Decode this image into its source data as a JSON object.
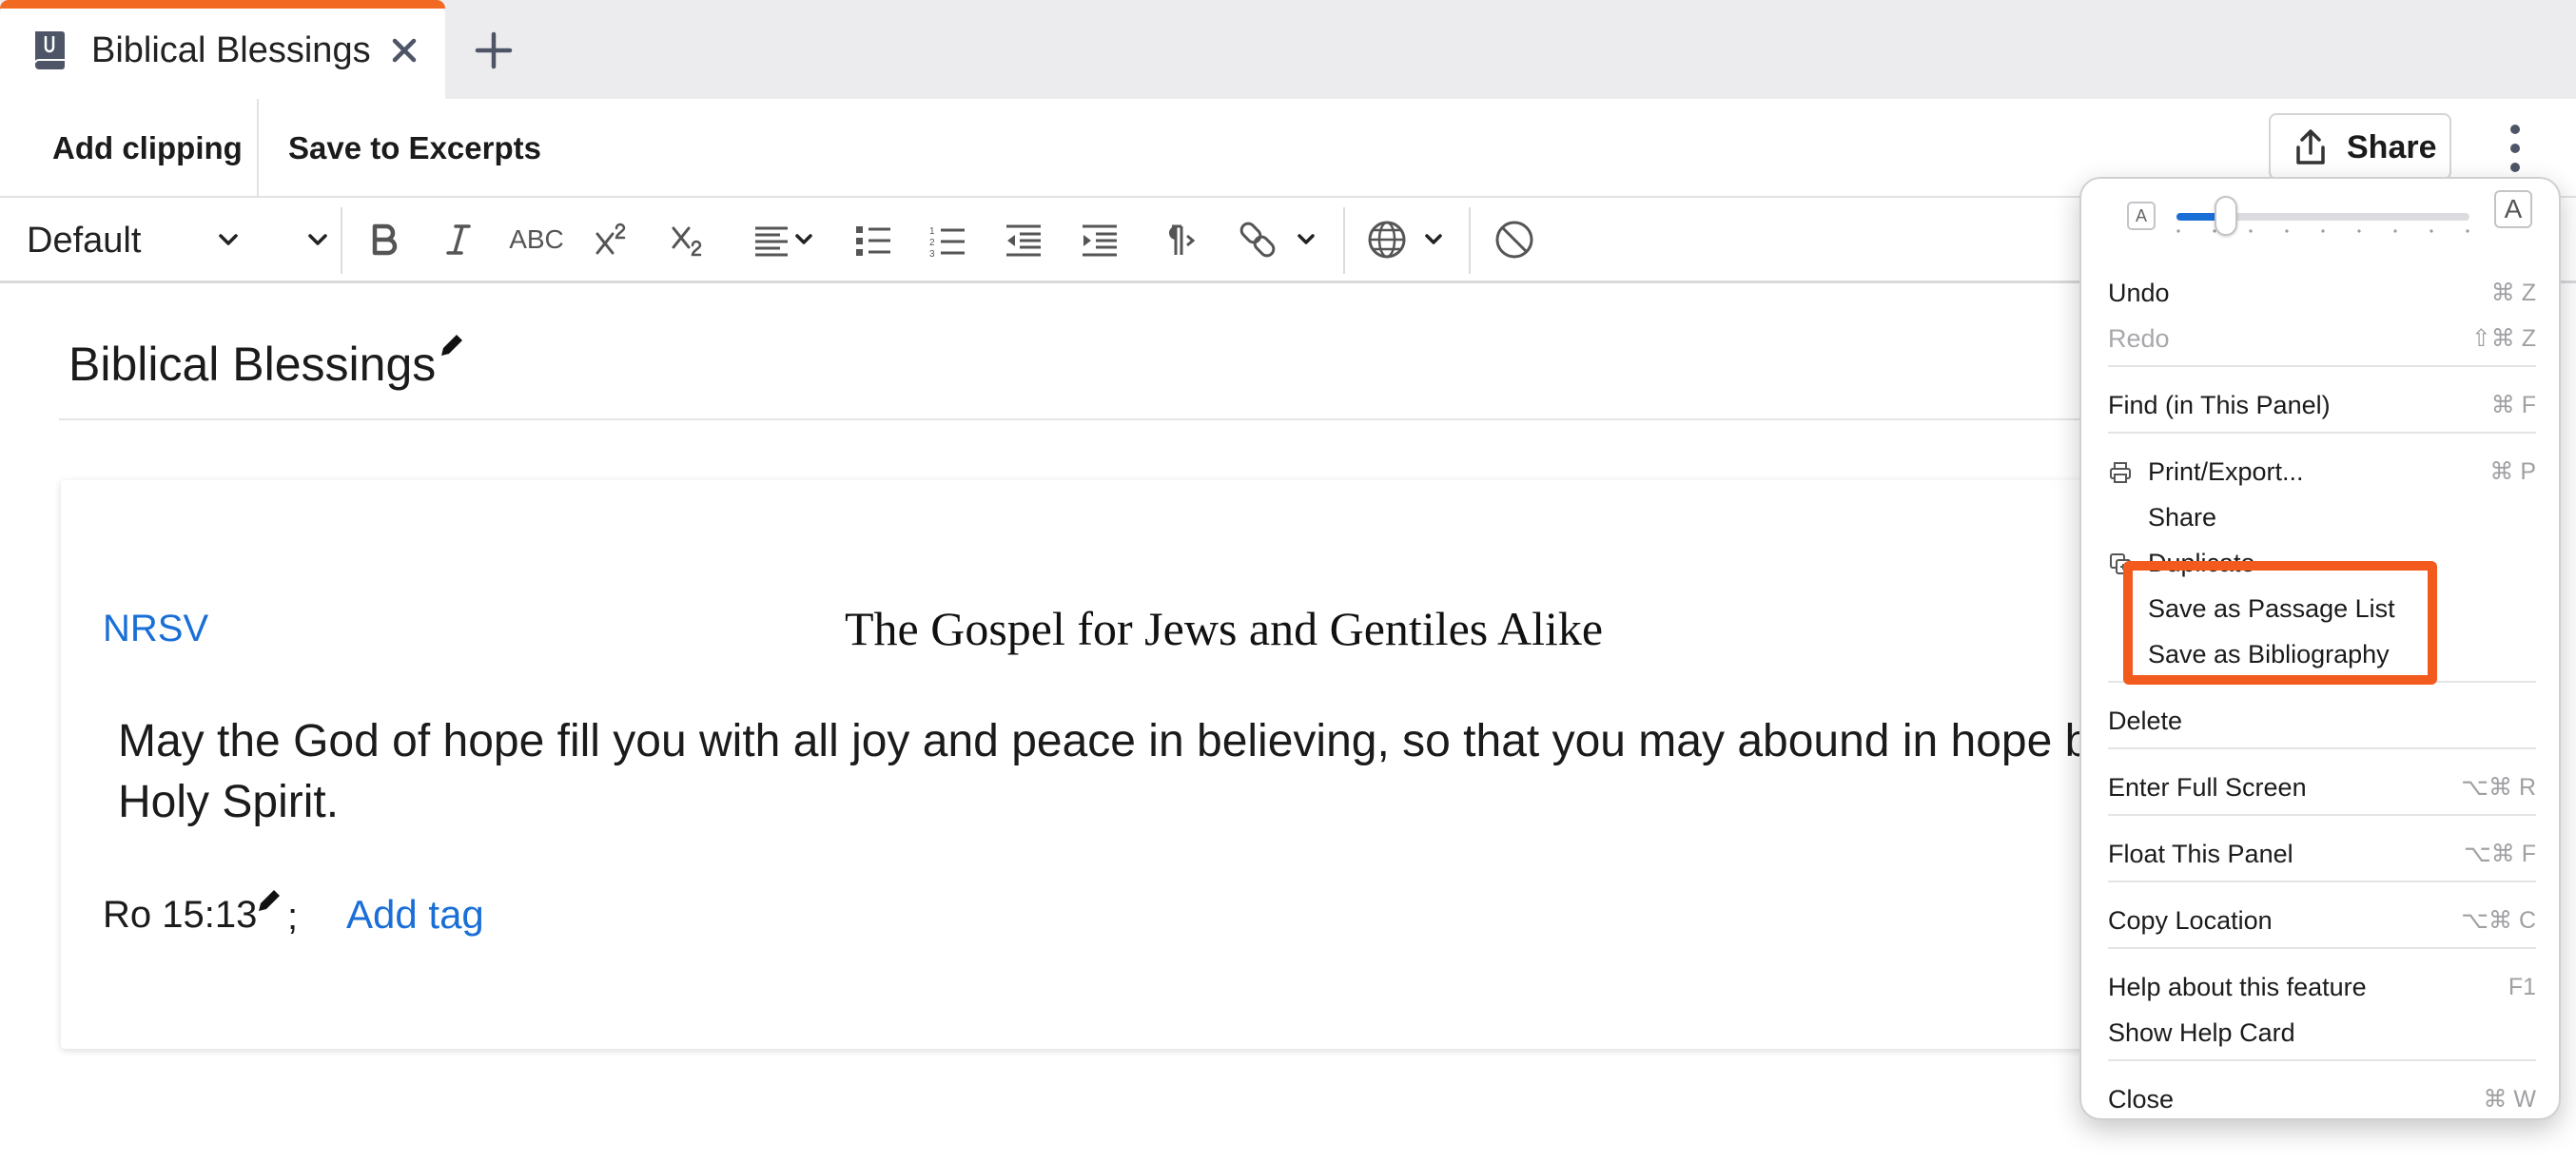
{
  "tab": {
    "title": "Biblical Blessings",
    "accent_color": "#f26a21"
  },
  "actions": {
    "add_clipping": "Add clipping",
    "save_to_excerpts": "Save to Excerpts",
    "share": "Share"
  },
  "format_toolbar": {
    "style_value": "Default",
    "strikethrough_label": "ABC"
  },
  "document": {
    "title": "Biblical Blessings",
    "version": "NRSV",
    "heading": "The Gospel for Jews and Gentiles Alike",
    "passage": "May the God of hope fill you with all joy and peace in believing, so that you may abound in hope b",
    "passage_line2": "Holy Spirit.",
    "reference": "Ro 15:13",
    "reference_separator": ";",
    "add_tag": "Add tag"
  },
  "menu": {
    "font_size_small_label": "A",
    "font_size_large_label": "A",
    "font_size_level": 0.17,
    "groups": [
      [
        {
          "label": "Undo",
          "shortcut": "⌘ Z"
        },
        {
          "label": "Redo",
          "shortcut": "⇧⌘ Z",
          "disabled": true
        }
      ],
      [
        {
          "label": "Find (in This Panel)",
          "shortcut": "⌘ F"
        }
      ],
      [
        {
          "label": "Print/Export...",
          "shortcut": "⌘ P",
          "icon": "printer-icon"
        },
        {
          "label": "Share"
        },
        {
          "label": "Duplicate",
          "icon": "duplicate-icon"
        },
        {
          "label": "Save as Passage List"
        },
        {
          "label": "Save as Bibliography"
        }
      ],
      [
        {
          "label": "Delete"
        }
      ],
      [
        {
          "label": "Enter Full Screen",
          "shortcut": "⌥⌘ R"
        }
      ],
      [
        {
          "label": "Float This Panel",
          "shortcut": "⌥⌘ F"
        }
      ],
      [
        {
          "label": "Copy Location",
          "shortcut": "⌥⌘ C"
        }
      ],
      [
        {
          "label": "Help about this feature",
          "shortcut": "F1"
        },
        {
          "label": "Show Help Card"
        }
      ],
      [
        {
          "label": "Close",
          "shortcut": "⌘ W"
        }
      ]
    ]
  },
  "highlight": {
    "color": "#f25a1e"
  }
}
